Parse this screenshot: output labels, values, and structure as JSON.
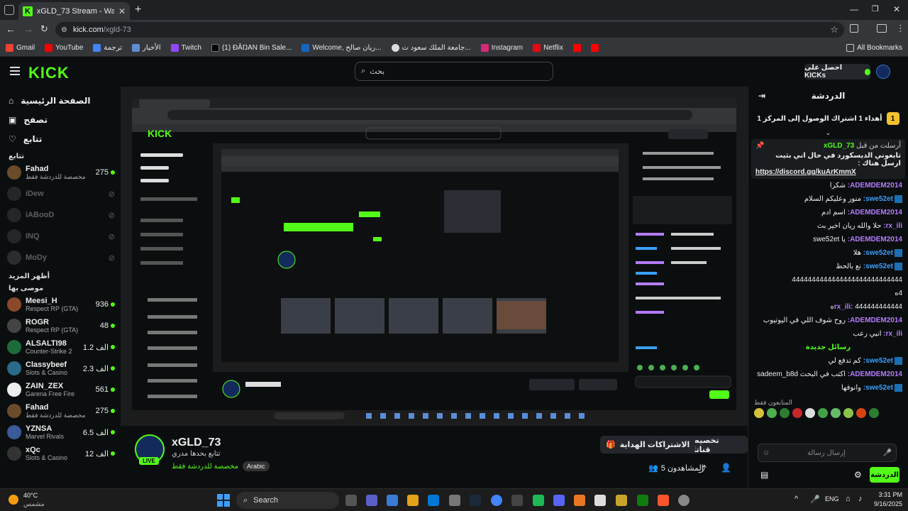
{
  "browser": {
    "tab_title": "xGLD_73 Stream - Watch Live o",
    "url_host": "kick.com",
    "url_path": "/xgld-73",
    "bookmarks": [
      "Gmail",
      "YouTube",
      "ترجمة",
      "الأخبار",
      "Twitch",
      "(1) ĐÂŊAN Bin Sale...",
      "Welcome, ريان صالح...",
      "جامعة الملك سعود ت...",
      "Instagram",
      "Netflix"
    ],
    "all_bookmarks": "All Bookmarks"
  },
  "kick": {
    "logo": "KICK",
    "search_placeholder": "بحث",
    "get_kicks": "احصل على KICKs"
  },
  "sidebar": {
    "nav": [
      "الصفحة الرئيسية",
      "تصفح",
      "تتابع"
    ],
    "following_heading": "تتابع",
    "following": [
      {
        "name": "Fahad",
        "sub": "مخصصة للدردشة فقط",
        "viewers": "275",
        "color": "#6a4b2a"
      },
      {
        "name": "iDew",
        "sub": "",
        "viewers": "",
        "color": "#555"
      },
      {
        "name": "iABooD",
        "sub": "",
        "viewers": "",
        "color": "#555"
      },
      {
        "name": "INQ",
        "sub": "",
        "viewers": "",
        "color": "#555"
      },
      {
        "name": "MoDy",
        "sub": "",
        "viewers": "",
        "color": "#666"
      }
    ],
    "show_more": "أظهر المزيد",
    "recommended_heading": "موصى بها",
    "recommended": [
      {
        "name": "Meesi_H",
        "sub": "Respect RP (GTA)",
        "viewers": "936",
        "color": "#8a4a2a"
      },
      {
        "name": "ROGR",
        "sub": "Respect RP (GTA)",
        "viewers": "48",
        "color": "#444"
      },
      {
        "name": "ALSALTI98",
        "sub": "Counter-Strike 2",
        "viewers": "1.2 الف",
        "color": "#1c6b3a"
      },
      {
        "name": "Classybeef",
        "sub": "Slots & Casino",
        "viewers": "2.3 الف",
        "color": "#2a6a8a"
      },
      {
        "name": "ZAIN_ZEX",
        "sub": "Garena Free Fire",
        "viewers": "561",
        "color": "#eee"
      },
      {
        "name": "Fahad",
        "sub": "مخصصة للدردشة فقط",
        "viewers": "275",
        "color": "#6a4b2a"
      },
      {
        "name": "YZNSA",
        "sub": "Marvel Rivals",
        "viewers": "6.5 الف",
        "color": "#3a5a9a"
      },
      {
        "name": "xQc",
        "sub": "Slots & Casino",
        "viewers": "12 الف",
        "color": "#333"
      }
    ]
  },
  "channel": {
    "name": "xGLD_73",
    "subtitle": "تتابع بحدها مدري",
    "category": "مخصصة للدردشة فقط",
    "language": "Arabic",
    "live": "LIVE",
    "viewers_label": "المشاهدون 5",
    "btn_customize": "تخصيص قناتك",
    "btn_gift_subs": "الاشتراكات الهداية"
  },
  "chat": {
    "title": "الدردشة",
    "gift_banner": "أهداء 1 اشتراك الوصول إلى المركز 1",
    "gift_rank": "1",
    "pinned_by": "أرسلت من قبل",
    "pinned_user": "xGLD_73",
    "pinned_text": "تابعوني الديسكورد في حال اني بثيت ارسل هناك :",
    "pinned_link": "https://discord.gg/kuArKmmX",
    "messages": [
      {
        "user": "ADEMDEM2014:",
        "text": "شكرا",
        "color": "#b57bff",
        "badge": false
      },
      {
        "user": "swe52et:",
        "text": "منور وعليكم السلام",
        "color": "#3aa0ff",
        "badge": true
      },
      {
        "user": "ADEMDEM2014:",
        "text": "اسم ادم",
        "color": "#b57bff",
        "badge": false
      },
      {
        "user": "rx_ili:",
        "text": "حلا والله ريان اخير بث",
        "color": "#b57bff",
        "badge": false
      },
      {
        "user": "ADEMDEM2014:",
        "text": "يا swe52et",
        "color": "#b57bff",
        "badge": false
      },
      {
        "user": "swe52et:",
        "text": "هلا",
        "color": "#3aa0ff",
        "badge": true
      },
      {
        "user": "swe52et:",
        "text": "نع بالحظ",
        "color": "#3aa0ff",
        "badge": true
      },
      {
        "user": "",
        "text": "4444444444444444444444444444",
        "color": "#fff",
        "badge": false
      },
      {
        "user": "",
        "text": "4ه",
        "color": "#fff",
        "badge": false
      },
      {
        "user": "rx_ili:",
        "text": "444444444444ه",
        "color": "#b57bff",
        "badge": false
      },
      {
        "user": "ADEMDEM2014:",
        "text": "روح شوف اللي في اليوتيوب",
        "color": "#b57bff",
        "badge": false
      },
      {
        "user": "rx_ili:",
        "text": "انبي رعب",
        "color": "#b57bff",
        "badge": false
      }
    ],
    "new_messages": "رسائل جديدة",
    "new": [
      {
        "user": "swe52et:",
        "text": "كم تدفع لي",
        "color": "#3aa0ff",
        "badge": true
      },
      {
        "user": "ADEMDEM2014:",
        "text": "اكتب في البحث sadeem_b8d",
        "color": "#b57bff",
        "badge": false
      },
      {
        "user": "swe52et:",
        "text": "وانوفها",
        "color": "#3aa0ff",
        "badge": true
      }
    ],
    "emotes_label": "المتابعون فقط",
    "input_placeholder": "إرسال رسالة",
    "send": "الدردشة"
  },
  "taskbar": {
    "weather_temp": "40°C",
    "weather_desc": "مشمس",
    "search": "Search",
    "lang": "ENG",
    "time": "3:31 PM",
    "date": "9/16/2025"
  }
}
